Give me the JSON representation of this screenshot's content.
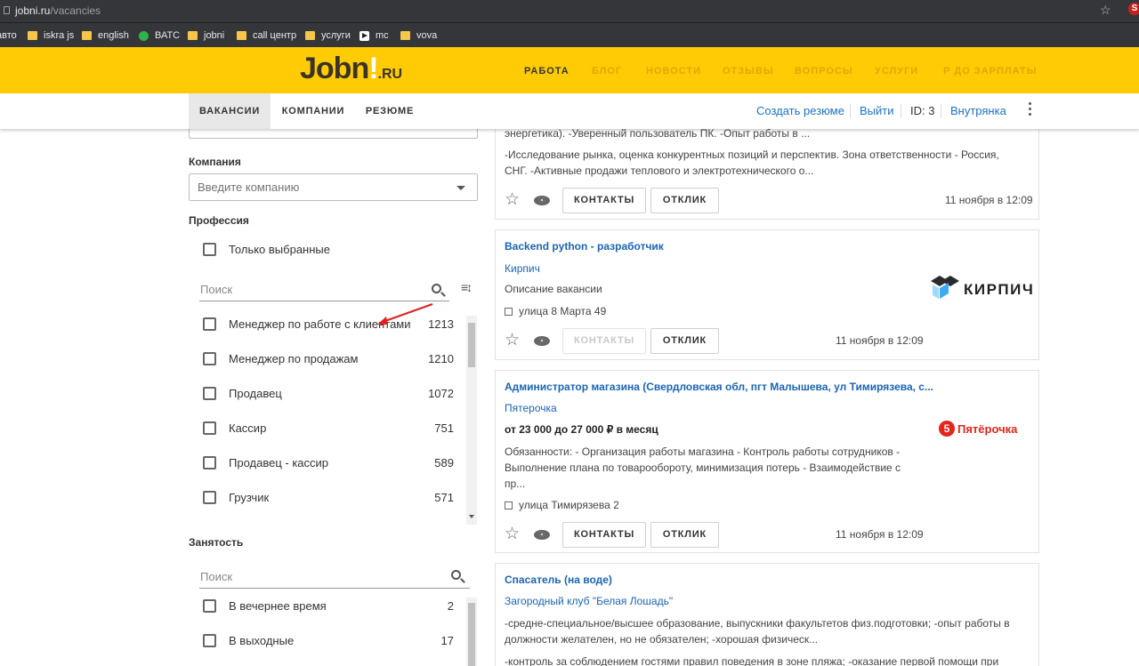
{
  "browser": {
    "url_host": "jobni.ru",
    "url_path": "/vacancies",
    "bookmarks": [
      {
        "label": "авто",
        "icon": "none"
      },
      {
        "label": "iskra js",
        "icon": "folder-icon"
      },
      {
        "label": "english",
        "icon": "folder-icon"
      },
      {
        "label": "ВАТС",
        "icon": "globe-icon"
      },
      {
        "label": "jobni",
        "icon": "folder-icon"
      },
      {
        "label": "call центр",
        "icon": "folder-icon"
      },
      {
        "label": "услуги",
        "icon": "folder-icon"
      },
      {
        "label": "mc",
        "icon": "play-icon"
      },
      {
        "label": "vova",
        "icon": "folder-icon"
      }
    ],
    "extension_letter": "S"
  },
  "header": {
    "logo_main": "Jobn",
    "logo_bang": "!",
    "logo_suffix": ".RU",
    "nav": [
      "РАБОТА",
      "БЛОГ",
      "НОВОСТИ",
      "ОТЗЫВЫ",
      "ВОПРОСЫ",
      "УСЛУГИ",
      "Р ДО ЗАРПЛАТЫ"
    ],
    "accent": "#ffcb05"
  },
  "subheader": {
    "tabs": [
      "ВАКАНСИИ",
      "КОМПАНИИ",
      "РЕЗЮМЕ"
    ],
    "links": [
      "Создать резюме",
      "Выйти",
      "ID: 3",
      "Внутрянка"
    ]
  },
  "sidebar": {
    "company_label": "Компания",
    "company_placeholder": "Введите компанию",
    "profession_label": "Профессия",
    "only_selected": "Только выбранные",
    "search_placeholder": "Поиск",
    "professions": [
      {
        "label": "Менеджер по работе с клиентами",
        "count": "1213"
      },
      {
        "label": "Менеджер по продажам",
        "count": "1210"
      },
      {
        "label": "Продавец",
        "count": "1072"
      },
      {
        "label": "Кассир",
        "count": "751"
      },
      {
        "label": "Продавец - кассир",
        "count": "589"
      },
      {
        "label": "Грузчик",
        "count": "571"
      }
    ],
    "employment_label": "Занятость",
    "employment_search_placeholder": "Поиск",
    "employment": [
      {
        "label": "В вечернее время",
        "count": "2"
      },
      {
        "label": "В выходные",
        "count": "17"
      }
    ]
  },
  "cards": {
    "card0": {
      "text1": "энергетика). -Уверенный пользователь ПК. -Опыт работы в ...",
      "text2a": "-Исследование рынка, оценка конкурентных позиций и перспектив. Зона ответственности - Россия,",
      "text2b": "СНГ. -Активные продажи теплового и электротехнического о...",
      "contacts": "КОНТАКТЫ",
      "reply": "ОТКЛИК",
      "date": "11 ноября в 12:09"
    },
    "card1": {
      "title": "Backend python - разработчик",
      "company": "Кирпич",
      "desc": "Описание вакансии",
      "address": "улица 8 Марта 49",
      "logo_text": "КИРПИЧ",
      "contacts": "КОНТАКТЫ",
      "reply": "ОТКЛИК",
      "date": "11 ноября в 12:09"
    },
    "card2": {
      "title": "Администратор магазина (Свердловская обл, пгт Малышева, ул Тимирязева, с...",
      "company": "Пятерочка",
      "salary": "от 23 000 до 27 000 ₽ в месяц",
      "desc1": "Обязанности: - Организация работы магазина - Контроль работы сотрудников -",
      "desc2": "Выполнение плана по товарообороту, минимизация потерь - Взаимодействие с",
      "desc3": "пр...",
      "address": "улица Тимирязева 2",
      "logo_num": "5",
      "logo_text": "Пятёрочка",
      "contacts": "КОНТАКТЫ",
      "reply": "ОТКЛИК",
      "date": "11 ноября в 12:09"
    },
    "card3": {
      "title": "Спасатель (на воде)",
      "company": "Загородный клуб \"Белая Лошадь\"",
      "desc1": "-средне-специальное/высшее образование, выпускники факультетов физ.подготовки; -опыт работы в",
      "desc2": "должности желателен, но не обязателен; -хорошая физическ...",
      "desc3": "-контроль за соблюдением гостями правил поведения в зоне пляжа; -оказание первой помощи при"
    }
  }
}
